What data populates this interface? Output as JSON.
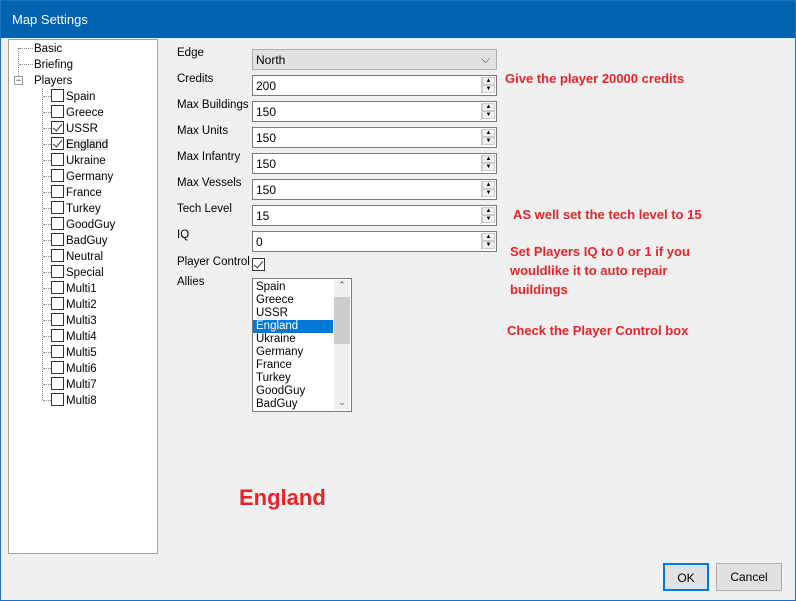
{
  "window": {
    "title": "Map Settings"
  },
  "tree": {
    "nodes": [
      "Basic",
      "Briefing",
      "Players"
    ],
    "players": [
      {
        "name": "Spain",
        "checked": false
      },
      {
        "name": "Greece",
        "checked": false
      },
      {
        "name": "USSR",
        "checked": true
      },
      {
        "name": "England",
        "checked": true,
        "selected": true
      },
      {
        "name": "Ukraine",
        "checked": false
      },
      {
        "name": "Germany",
        "checked": false
      },
      {
        "name": "France",
        "checked": false
      },
      {
        "name": "Turkey",
        "checked": false
      },
      {
        "name": "GoodGuy",
        "checked": false
      },
      {
        "name": "BadGuy",
        "checked": false
      },
      {
        "name": "Neutral",
        "checked": false
      },
      {
        "name": "Special",
        "checked": false
      },
      {
        "name": "Multi1",
        "checked": false
      },
      {
        "name": "Multi2",
        "checked": false
      },
      {
        "name": "Multi3",
        "checked": false
      },
      {
        "name": "Multi4",
        "checked": false
      },
      {
        "name": "Multi5",
        "checked": false
      },
      {
        "name": "Multi6",
        "checked": false
      },
      {
        "name": "Multi7",
        "checked": false
      },
      {
        "name": "Multi8",
        "checked": false
      }
    ]
  },
  "form": {
    "edge": {
      "label": "Edge",
      "value": "North"
    },
    "credits": {
      "label": "Credits",
      "value": "200"
    },
    "max_buildings": {
      "label": "Max Buildings",
      "value": "150"
    },
    "max_units": {
      "label": "Max Units",
      "value": "150"
    },
    "max_infantry": {
      "label": "Max Infantry",
      "value": "150"
    },
    "max_vessels": {
      "label": "Max Vessels",
      "value": "150"
    },
    "tech_level": {
      "label": "Tech Level",
      "value": "15"
    },
    "iq": {
      "label": "IQ",
      "value": "0"
    },
    "player_control": {
      "label": "Player Control",
      "checked": true
    },
    "allies": {
      "label": "Allies",
      "items": [
        "Spain",
        "Greece",
        "USSR",
        "England",
        "Ukraine",
        "Germany",
        "France",
        "Turkey",
        "GoodGuy",
        "BadGuy"
      ],
      "selected": "England"
    }
  },
  "notes": {
    "credits": "Give the player 20000 credits",
    "tech": "AS well set the tech level to 15",
    "iq1": "Set Players IQ to 0 or 1 if you",
    "iq2": "wouldlike it to auto repair",
    "iq3": "buildings",
    "control": "Check the Player Control box",
    "house": "England"
  },
  "buttons": {
    "ok": "OK",
    "cancel": "Cancel"
  }
}
